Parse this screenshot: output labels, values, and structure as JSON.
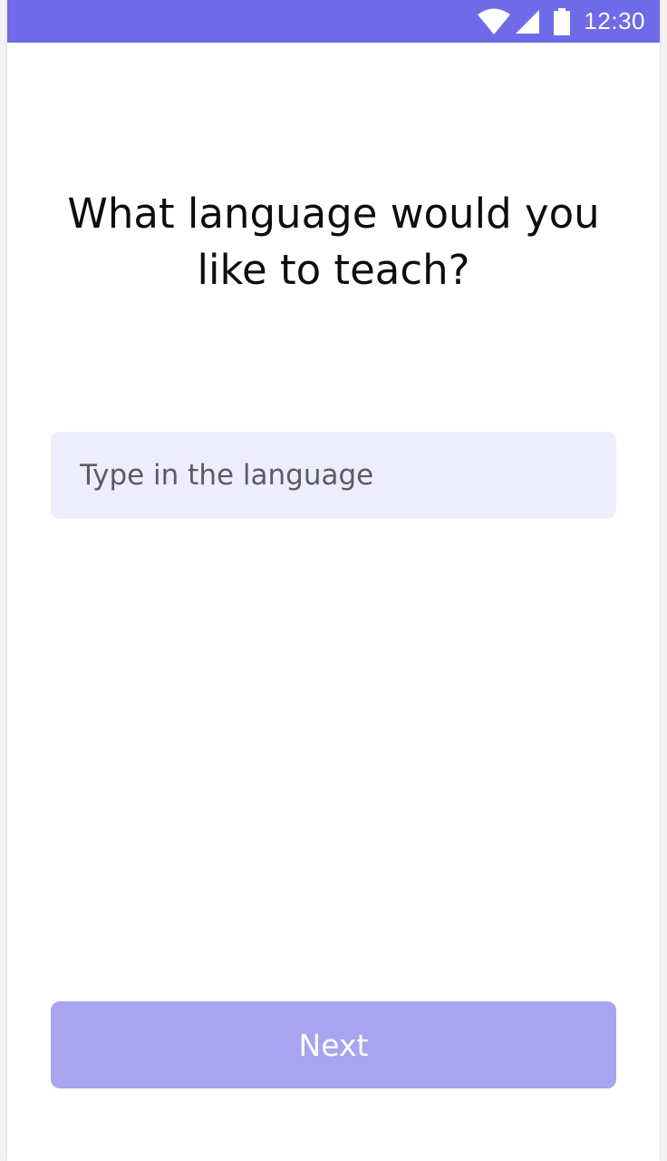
{
  "status_bar": {
    "time": "12:30",
    "icons": [
      "wifi-icon",
      "signal-icon",
      "battery-icon"
    ],
    "background_color": "#6e6ae8"
  },
  "onboarding": {
    "question_line1": "What language would you",
    "question_line2": "like to teach?",
    "language_input": {
      "value": "",
      "placeholder": "Type in the language"
    },
    "next_label": "Next"
  },
  "colors": {
    "accent": "#6e6ae8",
    "input_background": "#eeedfd",
    "button_disabled": "#a8a4ef"
  }
}
